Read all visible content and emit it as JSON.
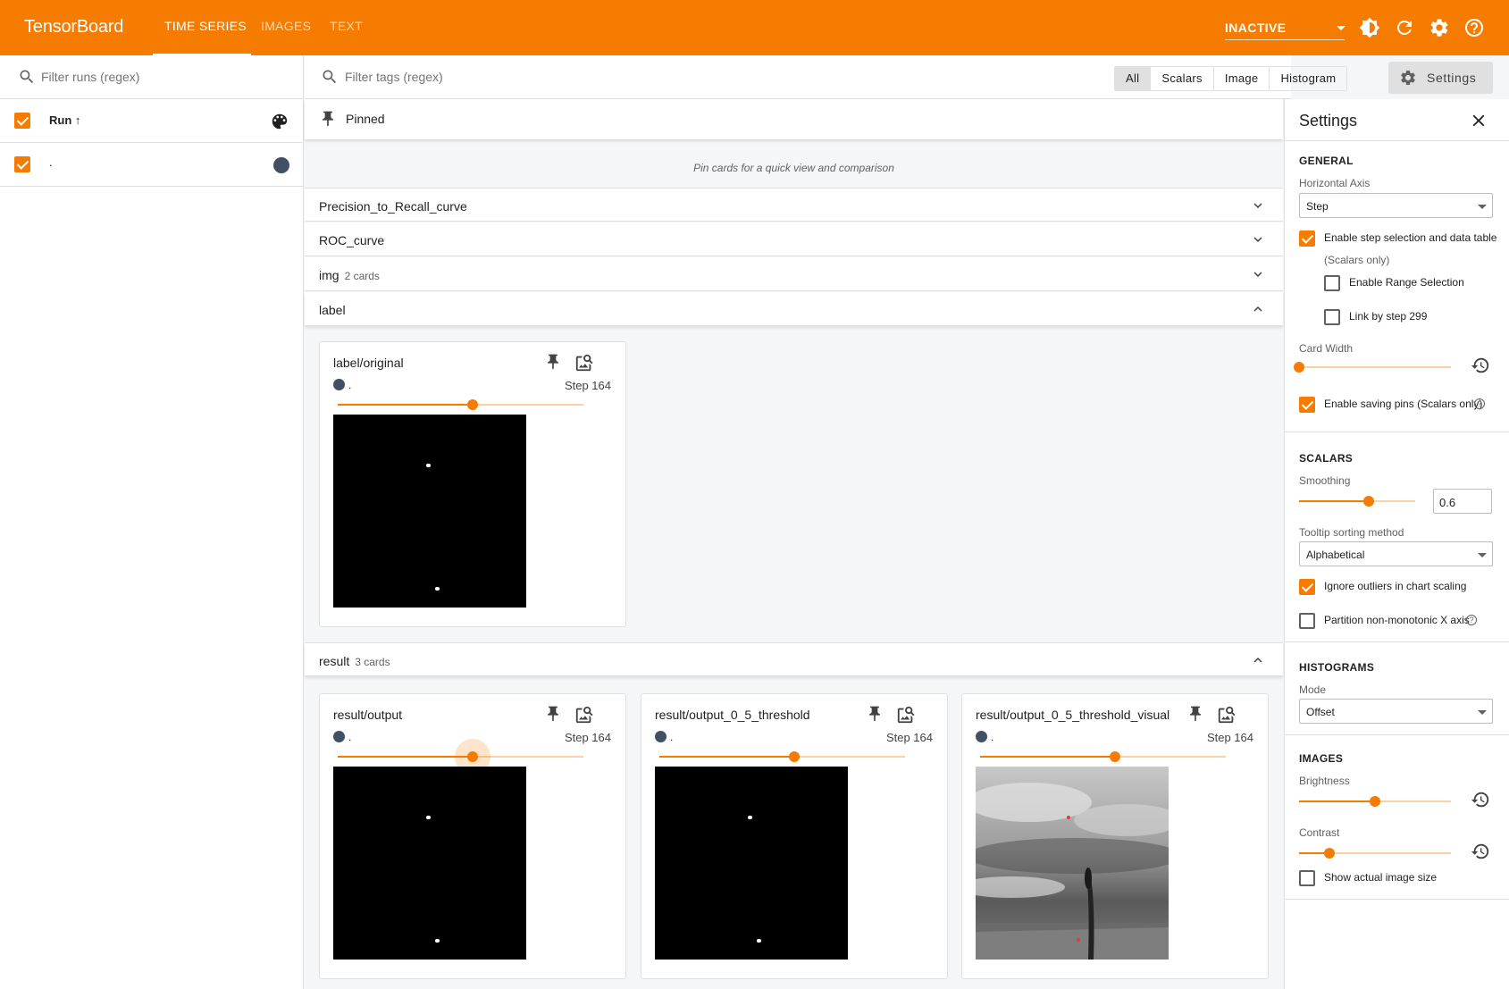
{
  "header": {
    "brand": "TensorBoard",
    "tabs": [
      {
        "label": "TIME SERIES",
        "active": true
      },
      {
        "label": "IMAGES",
        "active": false
      },
      {
        "label": "TEXT",
        "active": false
      }
    ],
    "status": "INACTIVE",
    "accent_color": "#f57c00"
  },
  "runs_panel": {
    "filter_placeholder": "Filter runs (regex)",
    "header_label": "Run ↑",
    "runs": [
      {
        "name": ".",
        "checked": true,
        "color": "#425066"
      }
    ]
  },
  "tag_filter": {
    "placeholder": "Filter tags (regex)",
    "types": [
      "All",
      "Scalars",
      "Image",
      "Histogram"
    ],
    "selected_type": "All",
    "settings_button": "Settings"
  },
  "pinned": {
    "title": "Pinned",
    "empty_message": "Pin cards for a quick view and comparison"
  },
  "groups": [
    {
      "name": "Precision_to_Recall_curve",
      "count": "",
      "expanded": false
    },
    {
      "name": "ROC_curve",
      "count": "",
      "expanded": false
    },
    {
      "name": "img",
      "count": "2 cards",
      "expanded": false
    },
    {
      "name": "label",
      "count": "",
      "expanded": true
    },
    {
      "name": "result",
      "count": "3 cards",
      "expanded": true
    }
  ],
  "cards": {
    "label": [
      {
        "title": "label/original",
        "run": ".",
        "step": "Step 164",
        "slider_fraction": 0.55,
        "image": "black-mask"
      }
    ],
    "result": [
      {
        "title": "result/output",
        "run": ".",
        "step": "Step 164",
        "slider_fraction": 0.55,
        "image": "black-mask"
      },
      {
        "title": "result/output_0_5_threshold",
        "run": ".",
        "step": "Step 164",
        "slider_fraction": 0.55,
        "image": "black-mask"
      },
      {
        "title": "result/output_0_5_threshold_visual",
        "run": ".",
        "step": "Step 164",
        "slider_fraction": 0.55,
        "image": "grayscale-photo"
      }
    ]
  },
  "settings": {
    "title": "Settings",
    "general": {
      "heading": "GENERAL",
      "horizontal_axis_label": "Horizontal Axis",
      "horizontal_axis_value": "Step",
      "step_selection_label": "Enable step selection and data table",
      "step_selection_sub": "(Scalars only)",
      "step_selection_checked": true,
      "range_selection_label": "Enable Range Selection",
      "range_selection_checked": false,
      "link_by_step_label": "Link by step 299",
      "link_by_step_checked": false,
      "card_width_label": "Card Width",
      "card_width_fraction": 0.0,
      "saving_pins_label": "Enable saving pins (Scalars only)",
      "saving_pins_checked": true
    },
    "scalars": {
      "heading": "SCALARS",
      "smoothing_label": "Smoothing",
      "smoothing_value": "0.6",
      "smoothing_fraction": 0.6,
      "tooltip_label": "Tooltip sorting method",
      "tooltip_value": "Alphabetical",
      "ignore_outliers_label": "Ignore outliers in chart scaling",
      "ignore_outliers_checked": true,
      "partition_label": "Partition non-monotonic X axis",
      "partition_checked": false
    },
    "histograms": {
      "heading": "HISTOGRAMS",
      "mode_label": "Mode",
      "mode_value": "Offset"
    },
    "images": {
      "heading": "IMAGES",
      "brightness_label": "Brightness",
      "brightness_fraction": 0.5,
      "contrast_label": "Contrast",
      "contrast_fraction": 0.2,
      "actual_size_label": "Show actual image size",
      "actual_size_checked": false
    }
  }
}
